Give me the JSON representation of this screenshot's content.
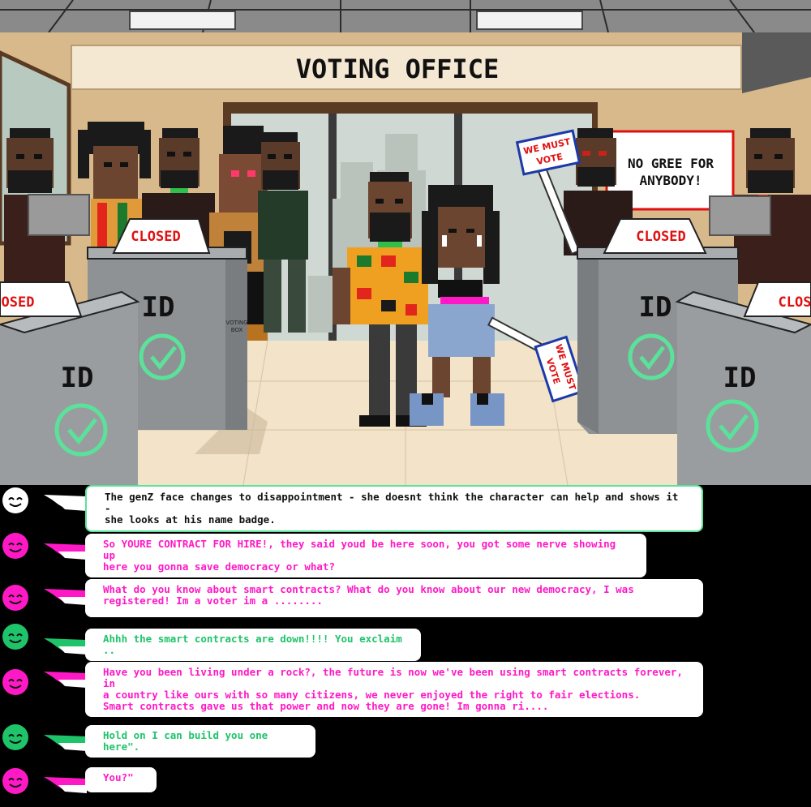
{
  "scene": {
    "office_sign": "VOTING OFFICE",
    "wall_poster": [
      "NO GREE FOR",
      "ANYBODY!"
    ],
    "closed_label": "CLOSED",
    "closed_label_cropped_left": "OSED",
    "closed_label_cropped_right": "CLOS",
    "id_label": "ID",
    "id_label_mirrored": "ID",
    "voting_box_label": [
      "VOTING",
      "BOX"
    ],
    "protest_sign": [
      "WE MUST",
      "VOTE"
    ]
  },
  "chat": {
    "messages": [
      {
        "speaker": "narrator",
        "color": "#ffffff",
        "text_lines": [
          "The genZ face changes to disappointment - she doesnt think the character can help and shows it -",
          "she looks at his name badge."
        ]
      },
      {
        "speaker": "genz",
        "color": "#ff19c6",
        "text_lines": [
          "So YOURE CONTRACT FOR HIRE!, they said youd be here soon, you got some nerve showing up",
          "here you gonna save democracy or what?"
        ]
      },
      {
        "speaker": "genz",
        "color": "#ff19c6",
        "text_lines": [
          "What do you know about smart contracts? What do you know about our new democracy, I was",
          "registered! Im a voter im a ........"
        ]
      },
      {
        "speaker": "player",
        "color": "#1fc46a",
        "text_lines": [
          "Ahhh the smart contracts are down!!!! You exclaim .."
        ]
      },
      {
        "speaker": "genz",
        "color": "#ff19c6",
        "text_lines": [
          "Have you been living under a rock?, the future is now we've been using smart contracts forever, in",
          "a country like ours with so many citizens, we never enjoyed the right to fair elections.",
          "Smart contracts gave us that power and now they are gone! Im gonna ri...."
        ]
      },
      {
        "speaker": "player",
        "color": "#1fc46a",
        "text_lines": [
          "Hold on I can build you one here\"."
        ]
      },
      {
        "speaker": "genz",
        "color": "#ff19c6",
        "text_lines": [
          "You?\""
        ]
      }
    ]
  }
}
